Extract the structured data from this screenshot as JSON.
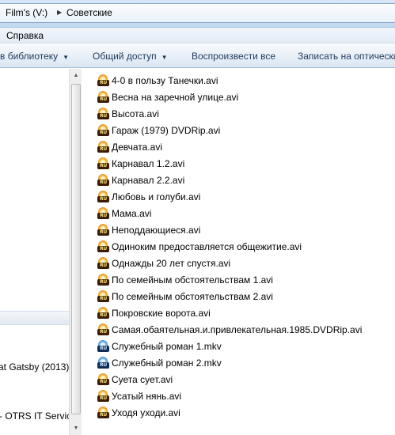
{
  "address": {
    "crumbs": [
      "Film's (V:)",
      "Советские"
    ]
  },
  "menu": {
    "help": "Справка"
  },
  "toolbar": {
    "library": "в библиотеку",
    "share": "Общий доступ",
    "play_all": "Воспроизвести все",
    "burn": "Записать на оптически"
  },
  "nav": {
    "item_gatsby": "at Gatsby (2013)",
    "item_otrs": "- OTRS IT Service"
  },
  "files": [
    {
      "name": "4-0 в пользу Танечки.avi",
      "type": "avi"
    },
    {
      "name": "Весна на заречной улице.avi",
      "type": "avi"
    },
    {
      "name": "Высота.avi",
      "type": "avi"
    },
    {
      "name": "Гараж (1979) DVDRip.avi",
      "type": "avi"
    },
    {
      "name": "Девчата.avi",
      "type": "avi"
    },
    {
      "name": "Карнавал 1.2.avi",
      "type": "avi"
    },
    {
      "name": "Карнавал 2.2.avi",
      "type": "avi"
    },
    {
      "name": "Любовь и голуби.avi",
      "type": "avi"
    },
    {
      "name": "Мама.avi",
      "type": "avi"
    },
    {
      "name": "Неподдающиеся.avi",
      "type": "avi"
    },
    {
      "name": "Одиноким предоставляется общежитие.avi",
      "type": "avi"
    },
    {
      "name": "Однажды 20 лет спустя.avi",
      "type": "avi"
    },
    {
      "name": "По семейным обстоятельствам 1.avi",
      "type": "avi"
    },
    {
      "name": "По семейным обстоятельствам 2.avi",
      "type": "avi"
    },
    {
      "name": "Покровские ворота.avi",
      "type": "avi"
    },
    {
      "name": "Самая.обаятельная.и.привлекательная.1985.DVDRip.avi",
      "type": "avi"
    },
    {
      "name": "Служебный роман 1.mkv",
      "type": "mkv"
    },
    {
      "name": "Служебный роман 2.mkv",
      "type": "mkv"
    },
    {
      "name": "Суета сует.avi",
      "type": "avi"
    },
    {
      "name": "Усатый нянь.avi",
      "type": "avi"
    },
    {
      "name": "Уходя уходи.avi",
      "type": "avi"
    }
  ],
  "icons": {
    "avi": "media-file-icon",
    "mkv": "mkv-media-file-icon",
    "badge": "RU"
  },
  "colors": {
    "toolbar_text": "#1e395b",
    "chrome_blue": "#c3d9f0"
  }
}
